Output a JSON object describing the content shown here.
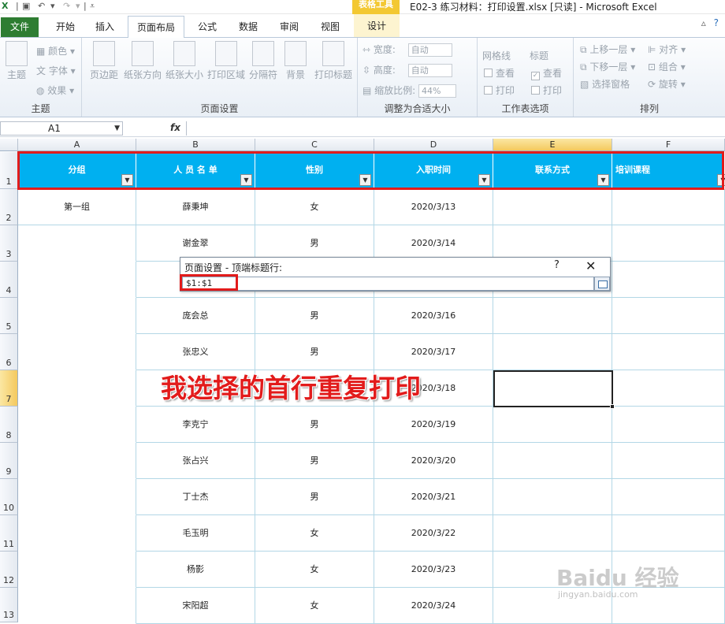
{
  "titlebar": {
    "context_tools": "表格工具",
    "window_title": "E02-3 练习材料：打印设置.xlsx  [只读]  -  Microsoft Excel"
  },
  "tabs": [
    "文件",
    "开始",
    "插入",
    "页面布局",
    "公式",
    "数据",
    "审阅",
    "视图",
    "设计"
  ],
  "ribbon": {
    "theme_group": {
      "label": "主题",
      "big": "主题",
      "items": [
        "颜色",
        "字体",
        "效果"
      ]
    },
    "page_setup_group": {
      "label": "页面设置",
      "buttons": [
        "页边距",
        "纸张方向",
        "纸张大小",
        "打印区域",
        "分隔符",
        "背景",
        "打印标题"
      ]
    },
    "scale_group": {
      "label": "调整为合适大小",
      "width_label": "宽度:",
      "width_value": "自动",
      "height_label": "高度:",
      "height_value": "自动",
      "scale_label": "缩放比例:",
      "scale_value": "44%"
    },
    "sheet_options_group": {
      "label": "工作表选项",
      "gridlines": "网格线",
      "headings": "标题",
      "view": "查看",
      "print": "打印"
    },
    "arrange_group": {
      "label": "排列",
      "items": [
        "上移一层",
        "下移一层",
        "选择窗格",
        "对齐",
        "组合",
        "旋转"
      ]
    }
  },
  "formula_bar": {
    "name_box": "A1",
    "fx": "fx",
    "content": ""
  },
  "columns": [
    "A",
    "B",
    "C",
    "D",
    "E",
    "F"
  ],
  "header_row": [
    "分组",
    "人 员 名 单",
    "性别",
    "入职时间",
    "联系方式",
    "培训课程"
  ],
  "rows": [
    {
      "num": "1"
    },
    {
      "num": "2",
      "a": "第一组",
      "b": "薛秉坤",
      "c": "女",
      "d": "2020/3/13"
    },
    {
      "num": "3",
      "a": "",
      "b": "谢金翠",
      "c": "男",
      "d": "2020/3/14"
    },
    {
      "num": "4",
      "a": "",
      "b": "",
      "c": "",
      "d": ""
    },
    {
      "num": "5",
      "a": "",
      "b": "庞会总",
      "c": "男",
      "d": "2020/3/16"
    },
    {
      "num": "6",
      "a": "",
      "b": "张忠义",
      "c": "男",
      "d": "2020/3/17"
    },
    {
      "num": "7",
      "a": "",
      "b": "",
      "c": "",
      "d": "2020/3/18"
    },
    {
      "num": "8",
      "a": "",
      "b": "李克宁",
      "c": "男",
      "d": "2020/3/19"
    },
    {
      "num": "9",
      "a": "",
      "b": "张占兴",
      "c": "男",
      "d": "2020/3/20"
    },
    {
      "num": "10",
      "a": "",
      "b": "丁士杰",
      "c": "男",
      "d": "2020/3/21"
    },
    {
      "num": "11",
      "a": "",
      "b": "毛玉明",
      "c": "女",
      "d": "2020/3/22"
    },
    {
      "num": "12",
      "a": "",
      "b": "杨影",
      "c": "女",
      "d": "2020/3/23"
    },
    {
      "num": "13",
      "a": "",
      "b": "宋阳超",
      "c": "女",
      "d": "2020/3/24"
    }
  ],
  "dialog": {
    "title": "页面设置 - 顶端标题行:",
    "help": "?",
    "close": "✕",
    "value": "$1:$1"
  },
  "annotation": "我选择的首行重复打印",
  "watermark": {
    "main": "Baidu 经验",
    "sub": "jingyan.baidu.com"
  },
  "colors": {
    "header_fill": "#00b0f0",
    "highlight": "#e21b1b",
    "file_tab": "#2e7d32",
    "context_tab": "#f3c832"
  }
}
